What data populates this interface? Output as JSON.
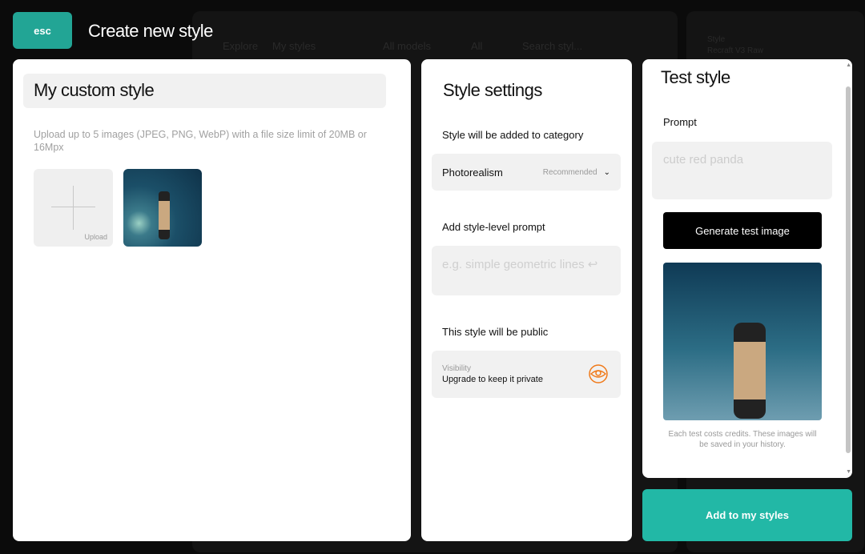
{
  "background": {
    "tabs": [
      "Explore",
      "My styles"
    ],
    "filters": [
      "All models",
      "All"
    ],
    "search_placeholder": "Search styl...",
    "style_label": "Style",
    "style_name": "Recraft V3 Raw"
  },
  "header": {
    "esc_label": "esc",
    "title": "Create new style"
  },
  "upload_panel": {
    "style_name": "My custom style",
    "hint": "Upload up to 5 images (JPEG, PNG, WebP) with a file size limit of 20MB or 16Mpx",
    "upload_label": "Upload"
  },
  "settings": {
    "title": "Style settings",
    "category_label": "Style will be added to category",
    "category_value": "Photorealism",
    "category_badge": "Recommended",
    "prompt_label": "Add style-level prompt",
    "prompt_placeholder": "e.g. simple geometric lines",
    "public_label": "This style will be public",
    "visibility_label": "Visibility",
    "visibility_text": "Upgrade to keep it private",
    "accent": "#f07a1a"
  },
  "test": {
    "title": "Test style",
    "prompt_label": "Prompt",
    "prompt_placeholder": "cute red panda",
    "generate_label": "Generate test image",
    "note": "Each test costs credits. These images will be saved in your history."
  },
  "add_label": "Add to my styles",
  "colors": {
    "teal": "#22b8a6",
    "esc": "#22a595"
  }
}
